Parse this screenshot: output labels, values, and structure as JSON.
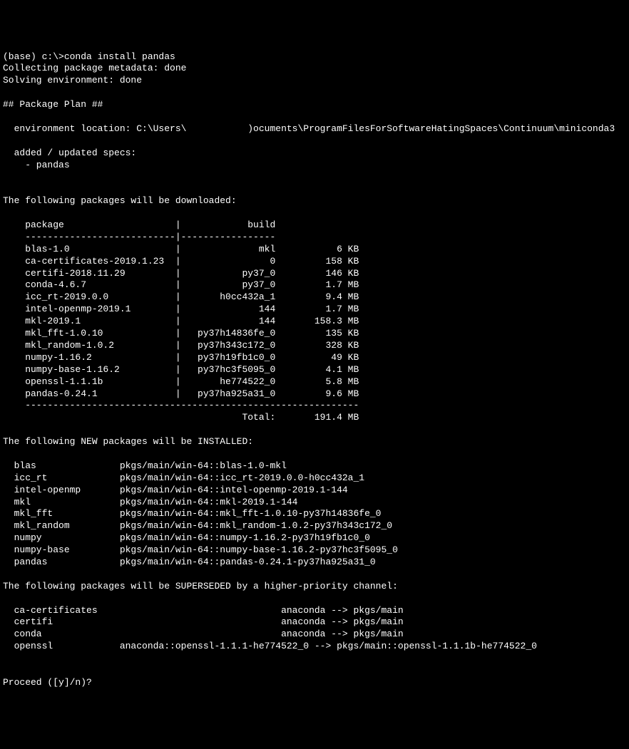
{
  "prompt": "(base) c:\\>conda install pandas",
  "collecting": "Collecting package metadata: done",
  "solving": "Solving environment: done",
  "plan_header": "## Package Plan ##",
  "env_location": "  environment location: C:\\Users\\           )ocuments\\ProgramFilesForSoftwareHatingSpaces\\Continuum\\miniconda3",
  "added_specs_label": "  added / updated specs:",
  "added_specs_item": "    - pandas",
  "download_header": "The following packages will be downloaded:",
  "table_header_package": "    package                    |            build",
  "table_divider1": "    ---------------------------|-----------------",
  "packages": [
    {
      "line": "    blas-1.0                   |              mkl           6 KB"
    },
    {
      "line": "    ca-certificates-2019.1.23  |                0         158 KB"
    },
    {
      "line": "    certifi-2018.11.29         |           py37_0         146 KB"
    },
    {
      "line": "    conda-4.6.7                |           py37_0         1.7 MB"
    },
    {
      "line": "    icc_rt-2019.0.0            |       h0cc432a_1         9.4 MB"
    },
    {
      "line": "    intel-openmp-2019.1        |              144         1.7 MB"
    },
    {
      "line": "    mkl-2019.1                 |              144       158.3 MB"
    },
    {
      "line": "    mkl_fft-1.0.10             |   py37h14836fe_0         135 KB"
    },
    {
      "line": "    mkl_random-1.0.2           |   py37h343c172_0         328 KB"
    },
    {
      "line": "    numpy-1.16.2               |   py37h19fb1c0_0          49 KB"
    },
    {
      "line": "    numpy-base-1.16.2          |   py37hc3f5095_0         4.1 MB"
    },
    {
      "line": "    openssl-1.1.1b             |       he774522_0         5.8 MB"
    },
    {
      "line": "    pandas-0.24.1              |   py37ha925a31_0         9.6 MB"
    }
  ],
  "table_divider2": "    ------------------------------------------------------------",
  "total_line": "                                           Total:       191.4 MB",
  "install_header": "The following NEW packages will be INSTALLED:",
  "installs": [
    {
      "line": "  blas               pkgs/main/win-64::blas-1.0-mkl"
    },
    {
      "line": "  icc_rt             pkgs/main/win-64::icc_rt-2019.0.0-h0cc432a_1"
    },
    {
      "line": "  intel-openmp       pkgs/main/win-64::intel-openmp-2019.1-144"
    },
    {
      "line": "  mkl                pkgs/main/win-64::mkl-2019.1-144"
    },
    {
      "line": "  mkl_fft            pkgs/main/win-64::mkl_fft-1.0.10-py37h14836fe_0"
    },
    {
      "line": "  mkl_random         pkgs/main/win-64::mkl_random-1.0.2-py37h343c172_0"
    },
    {
      "line": "  numpy              pkgs/main/win-64::numpy-1.16.2-py37h19fb1c0_0"
    },
    {
      "line": "  numpy-base         pkgs/main/win-64::numpy-base-1.16.2-py37hc3f5095_0"
    },
    {
      "line": "  pandas             pkgs/main/win-64::pandas-0.24.1-py37ha925a31_0"
    }
  ],
  "supersede_header": "The following packages will be SUPERSEDED by a higher-priority channel:",
  "supersedes": [
    {
      "line": "  ca-certificates                                 anaconda --> pkgs/main"
    },
    {
      "line": "  certifi                                         anaconda --> pkgs/main"
    },
    {
      "line": "  conda                                           anaconda --> pkgs/main"
    },
    {
      "line": "  openssl            anaconda::openssl-1.1.1-he774522_0 --> pkgs/main::openssl-1.1.1b-he774522_0"
    }
  ],
  "proceed_prompt": "Proceed ([y]/n)?"
}
